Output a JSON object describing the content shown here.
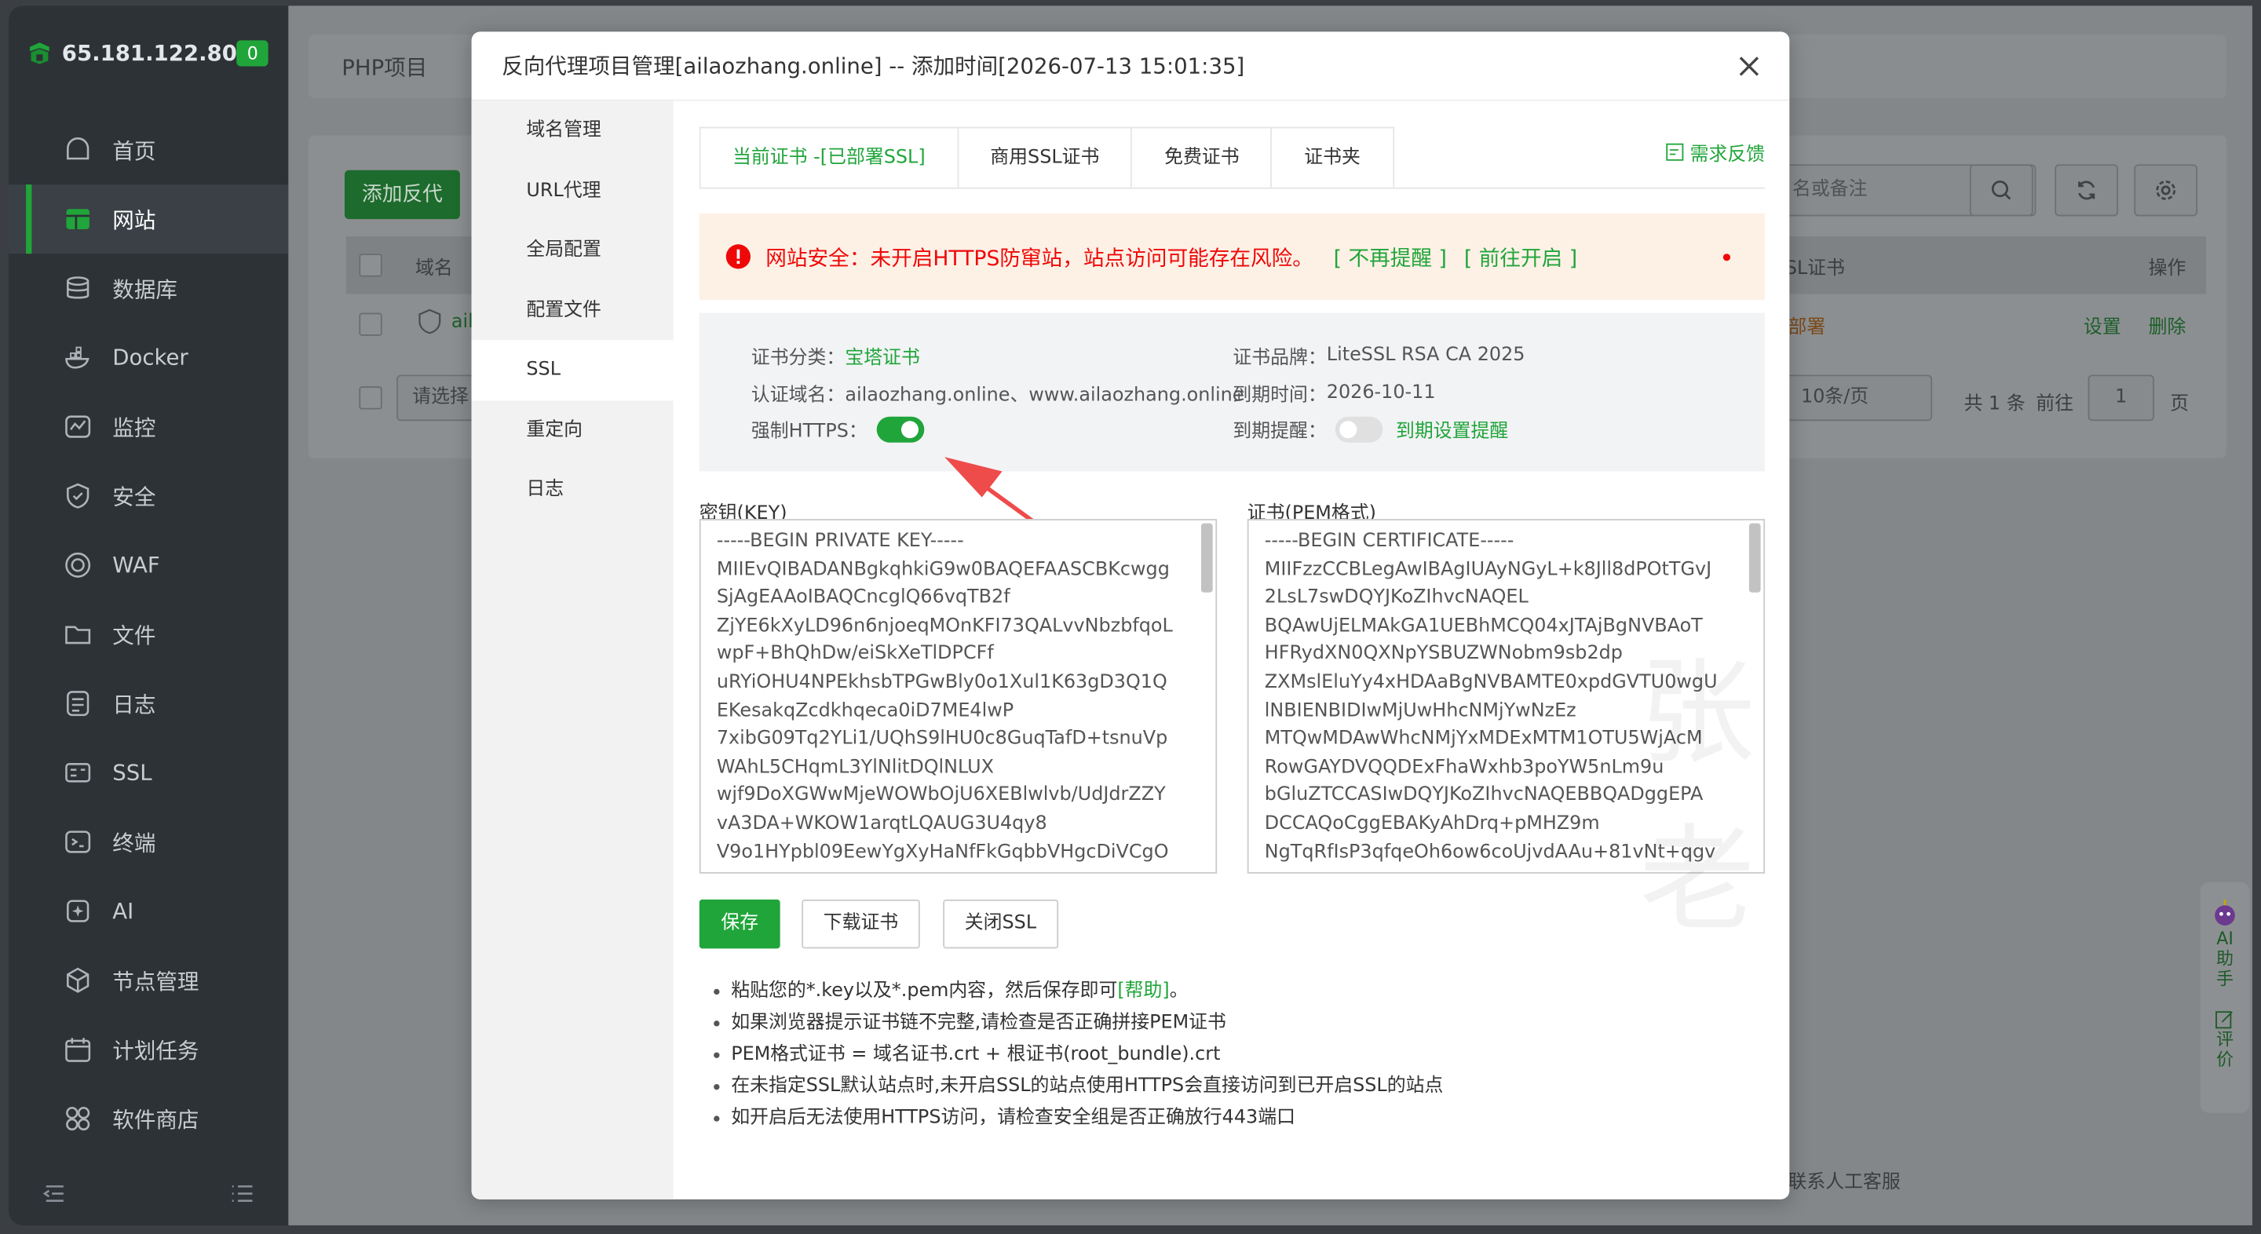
{
  "sidebar": {
    "ip": "65.181.122.80",
    "badge": "0",
    "items": [
      {
        "label": "首页",
        "icon": "home-icon"
      },
      {
        "label": "网站",
        "icon": "website-icon"
      },
      {
        "label": "数据库",
        "icon": "database-icon"
      },
      {
        "label": "Docker",
        "icon": "docker-icon"
      },
      {
        "label": "监控",
        "icon": "monitor-icon"
      },
      {
        "label": "安全",
        "icon": "shield-icon"
      },
      {
        "label": "WAF",
        "icon": "waf-icon"
      },
      {
        "label": "文件",
        "icon": "folder-icon"
      },
      {
        "label": "日志",
        "icon": "log-icon"
      },
      {
        "label": "SSL",
        "icon": "ssl-icon"
      },
      {
        "label": "终端",
        "icon": "terminal-icon"
      },
      {
        "label": "AI",
        "icon": "ai-icon"
      },
      {
        "label": "节点管理",
        "icon": "node-icon"
      },
      {
        "label": "计划任务",
        "icon": "calendar-icon"
      },
      {
        "label": "软件商店",
        "icon": "store-icon"
      }
    ]
  },
  "background": {
    "page_title": "PHP项目",
    "add_button": "添加反代",
    "search_placeholder": "名或备注",
    "col_domain": "域名",
    "col_ssl": "SL证书",
    "col_ops": "操作",
    "row_name": "ail",
    "row_ssl": "部署",
    "row_set": "设置",
    "row_del": "删除",
    "batch_placeholder": "请选择",
    "page_size": "10条/页",
    "total": "共 1 条",
    "goto": "前往",
    "page_num": "1",
    "page_unit": "页",
    "support": "联系人工客服",
    "ai_assistant": [
      "AI",
      "助",
      "手"
    ],
    "ai_review": [
      "评",
      "价"
    ]
  },
  "dialog": {
    "title": "反向代理项目管理[ailaozhang.online] -- 添加时间[2026-07-13 15:01:35]",
    "nav": [
      "域名管理",
      "URL代理",
      "全局配置",
      "配置文件",
      "SSL",
      "重定向",
      "日志"
    ],
    "tabs": [
      "当前证书 -[已部署SSL]",
      "商用SSL证书",
      "免费证书",
      "证书夹"
    ],
    "feedback": "需求反馈",
    "alert": {
      "text": "网站安全：未开启HTTPS防窜站，站点访问可能存在风险。",
      "link1": "[ 不再提醒 ]",
      "link2": "[ 前往开启 ]"
    },
    "cert": {
      "category_label": "证书分类：",
      "category_value": "宝塔证书",
      "domain_label": "认证域名：",
      "domain_value": "ailaozhang.online、www.ailaozhang.online",
      "https_label": "强制HTTPS：",
      "https_enabled": true,
      "brand_label": "证书品牌：",
      "brand_value": "LiteSSL RSA CA 2025",
      "expire_label": "到期时间：",
      "expire_value": "2026-10-11",
      "remind_label": "到期提醒：",
      "remind_enabled": false,
      "remind_link": "到期设置提醒"
    },
    "key_label": "密钥(KEY)",
    "key_text": "-----BEGIN PRIVATE KEY-----\nMIIEvQIBADANBgkqhkiG9w0BAQEFAASCBKcwgg\nSjAgEAAoIBAQCncglQ66vqTB2f\nZjYE6kXyLD96n6njoeqMOnKFI73QALvvNbzbfqoL\nwpF+BhQhDw/eiSkXeTlDPCFf\nuRYiOHU4NPEkhsbTPGwBly0o1Xul1K63gD3Q1Q\nEKesakqZcdkhqeca0iD7ME4lwP\n7xibG09Tq2YLi1/UQhS9lHU0c8GuqTafD+tsnuVp\nWAhL5CHqmL3YlNlitDQlNLUX\nwjf9DoXGWwMjeWOWbOjU6XEBlwlvb/UdJdrZZY\nvA3DA+WKOW1arqtLQAUG3U4qy8\nV9o1HYpbl09EewYgXyHaNfFkGqbbVHgcDiVCgO",
    "cert_label": "证书(PEM格式)",
    "cert_text": "-----BEGIN CERTIFICATE-----\nMIIFzzCCBLegAwIBAgIUAyNGyL+k8Jll8dPOtTGvJ\n2LsL7swDQYJKoZIhvcNAQEL\nBQAwUjELMAkGA1UEBhMCQ04xJTAjBgNVBAoT\nHFRydXN0QXNpYSBUZWNobm9sb2dp\nZXMslEluYy4xHDAaBgNVBAMTE0xpdGVTU0wgU\nlNBIENBIDIwMjUwHhcNMjYwNzEz\nMTQwMDAwWhcNMjYxMDExMTM1OTU5WjAcM\nRowGAYDVQQDExFhaWxhb3poYW5nLm9u\nbGluZTCCASIwDQYJKoZIhvcNAQEBBQADggEPA\nDCCAQoCggEBAKyAhDrq+pMHZ9m\nNgTqRfIsP3qfqeOh6ow6coUjvdAAu+81vNt+qgv",
    "buttons": {
      "save": "保存",
      "download": "下载证书",
      "close_ssl": "关闭SSL"
    },
    "tips": [
      {
        "text": "粘贴您的*.key以及*.pem内容，然后保存即可",
        "help": "[帮助]",
        "tail": "。"
      },
      {
        "text": "如果浏览器提示证书链不完整,请检查是否正确拼接PEM证书"
      },
      {
        "text": "PEM格式证书 = 域名证书.crt + 根证书(root_bundle).crt"
      },
      {
        "text": "在未指定SSL默认站点时,未开启SSL的站点使用HTTPS会直接访问到已开启SSL的站点"
      },
      {
        "text": "如开启后无法使用HTTPS访问，请检查安全组是否正确放行443端口"
      }
    ]
  },
  "colors": {
    "accent": "#20a53a",
    "danger": "#ef0808",
    "alert_bg": "#fdf1e6"
  }
}
